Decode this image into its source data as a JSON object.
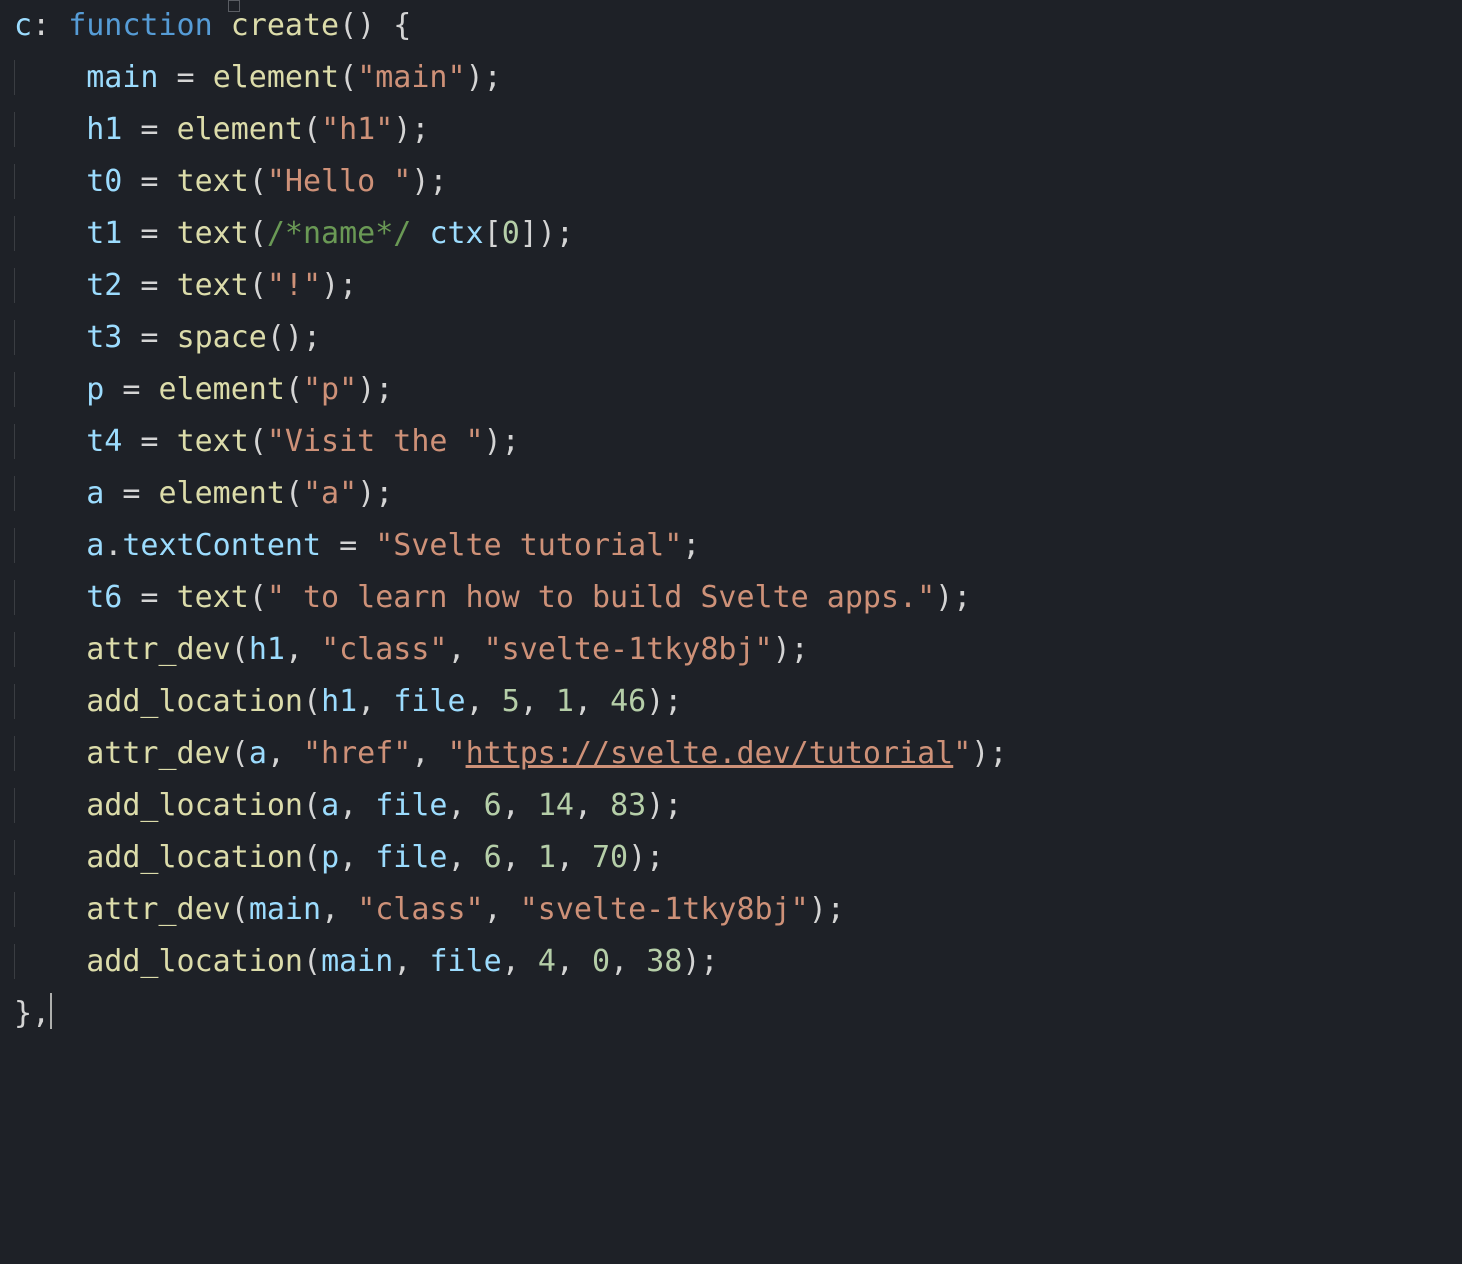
{
  "code": {
    "propKey": "c",
    "keyword_function": "function",
    "funcName": "create",
    "lines": {
      "assign": {
        "main_var": "main",
        "h1_var": "h1",
        "t0_var": "t0",
        "t1_var": "t1",
        "t2_var": "t2",
        "t3_var": "t3",
        "p_var": "p",
        "t4_var": "t4",
        "a_var": "a",
        "t6_var": "t6"
      },
      "calls": {
        "element": "element",
        "text": "text",
        "space": "space",
        "attr_dev": "attr_dev",
        "add_location": "add_location"
      },
      "strings": {
        "main": "\"main\"",
        "h1": "\"h1\"",
        "hello": "\"Hello \"",
        "bang": "\"!\"",
        "p": "\"p\"",
        "visit": "\"Visit the \"",
        "a": "\"a\"",
        "svelte_tutorial": "\"Svelte tutorial\"",
        "t6_text": "\" to learn how to build Svelte apps.\"",
        "class": "\"class\"",
        "svelte_hash": "\"svelte-1tky8bj\"",
        "href": "\"href\"",
        "url": "\"https://svelte.dev/tutorial\"",
        "url_inner": "https://svelte.dev/tutorial"
      },
      "comment_name": "/*name*/",
      "ctx": "ctx",
      "ctx_idx": "0",
      "textContent_prop": "textContent",
      "file_ident": "file",
      "nums": {
        "h1_loc": [
          "5",
          "1",
          "46"
        ],
        "a_loc": [
          "6",
          "14",
          "83"
        ],
        "p_loc": [
          "6",
          "1",
          "70"
        ],
        "main_loc": [
          "4",
          "0",
          "38"
        ]
      }
    },
    "closing": "},"
  }
}
